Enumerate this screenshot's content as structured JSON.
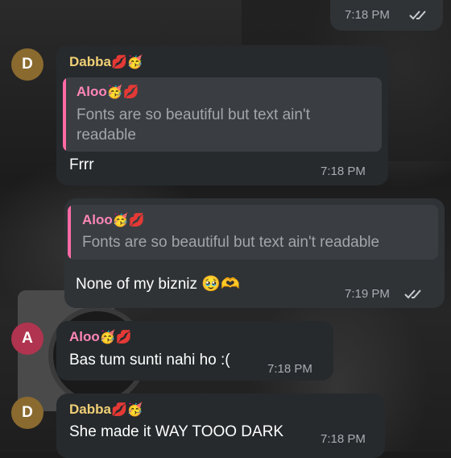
{
  "chat": {
    "top_status": {
      "time": "7:18 PM",
      "read": "double-check-icon"
    },
    "messages": [
      {
        "sender": "Dabba",
        "sender_emoji": "💋🥳",
        "avatar_letter": "D",
        "avatar_color": "#8a6a2f",
        "reply_to": {
          "name": "Aloo",
          "name_emoji": "🥳💋",
          "text": "Fonts are so beautiful but text ain't readable"
        },
        "text": "Frrr",
        "time": "7:18 PM"
      },
      {
        "direction": "outgoing",
        "reply_to": {
          "name": "Aloo",
          "name_emoji": "🥳💋",
          "text": "Fonts are so beautiful but text ain't readable"
        },
        "text": "None of my bizniz",
        "text_emoji": "🥹🫶",
        "time": "7:19 PM",
        "read": "double-check-icon"
      },
      {
        "sender": "Aloo",
        "sender_emoji": "🥳💋",
        "avatar_letter": "A",
        "avatar_color": "#b0344f",
        "text": "Bas tum sunti nahi ho :(",
        "time": "7:18 PM"
      },
      {
        "sender": "Dabba",
        "sender_emoji": "💋🥳",
        "avatar_letter": "D",
        "avatar_color": "#8a6a2f",
        "text": "She made it WAY TOOO DARK",
        "time": "7:18 PM"
      }
    ]
  },
  "colors": {
    "bubble_in": "#262a2d",
    "bubble_out": "#2f3336",
    "name_gold": "#f0cf74",
    "name_pink": "#ff86b7",
    "quote_bar": "#ff6aa5",
    "timestamp": "#a9adb2"
  }
}
